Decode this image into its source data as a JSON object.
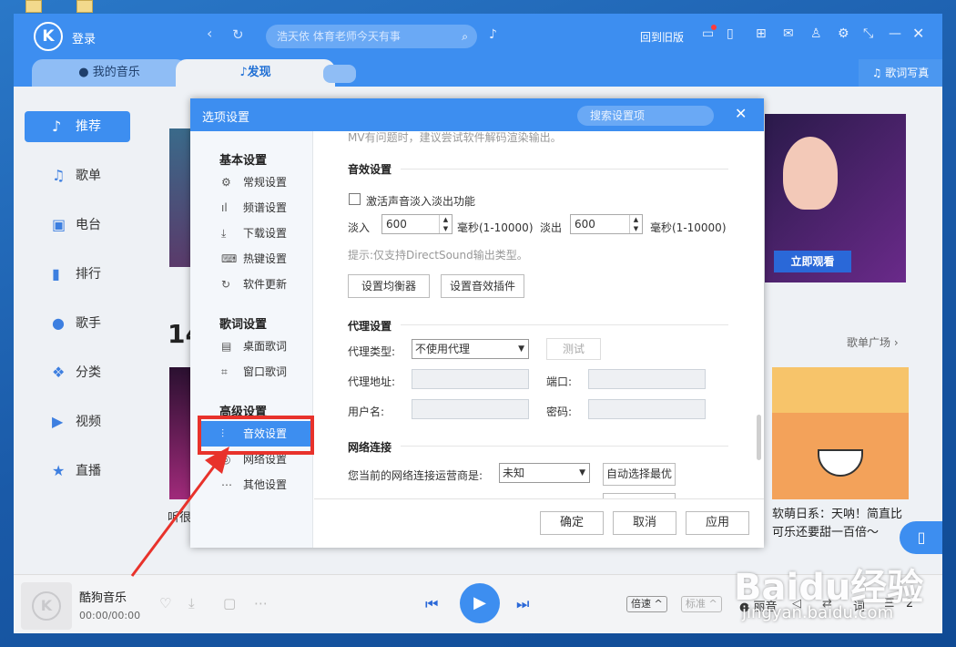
{
  "app": {
    "login": "登录",
    "search_placeholder": "浩天依 体育老师今天有事",
    "old_version": "回到旧版",
    "logo_letter": "K"
  },
  "tabs": {
    "my_music": "我的音乐",
    "discover": "发现",
    "lyrics_photo": "歌词写真"
  },
  "sidebar": {
    "items": [
      {
        "label": "推荐",
        "icon": "music-note-icon"
      },
      {
        "label": "歌单",
        "icon": "playlist-icon"
      },
      {
        "label": "电台",
        "icon": "radio-icon"
      },
      {
        "label": "排行",
        "icon": "chart-icon"
      },
      {
        "label": "歌手",
        "icon": "singer-icon"
      },
      {
        "label": "分类",
        "icon": "category-icon"
      },
      {
        "label": "视频",
        "icon": "video-icon"
      },
      {
        "label": "直播",
        "icon": "live-icon"
      }
    ]
  },
  "content": {
    "section_number": "14",
    "playlist_square": "歌单广场 ›",
    "banner_button": "立即观看",
    "left_caption": "听很",
    "right_caption": "软萌日系：天呐！简直比可乐还要甜一百倍～"
  },
  "player": {
    "song": "酷狗音乐",
    "time": "00:00/00:00",
    "speed": "倍速",
    "quality": "标准",
    "effect": "丽音",
    "lyric": "词",
    "count": "2"
  },
  "dialog": {
    "title": "选项设置",
    "search": "搜索设置项",
    "groups": {
      "basic": "基本设置",
      "lyrics": "歌词设置",
      "advanced": "高级设置"
    },
    "items": {
      "general": "常规设置",
      "spectrum": "频谱设置",
      "download": "下载设置",
      "hotkey": "热键设置",
      "update": "软件更新",
      "desktop_lyric": "桌面歌词",
      "window_lyric": "窗口歌词",
      "sound_effect": "音效设置",
      "network": "网络设置",
      "other": "其他设置"
    },
    "cut_text": "MV有问题时，建议尝试软件解码渲染输出。",
    "sound": {
      "title": "音效设置",
      "fade_check": "激活声音淡入淡出功能",
      "fade_in_label": "淡入",
      "fade_in_value": "600",
      "fade_in_unit": "毫秒(1-10000)",
      "fade_out_label": "淡出",
      "fade_out_value": "600",
      "fade_out_unit": "毫秒(1-10000)",
      "hint": "提示:仅支持DirectSound输出类型。",
      "eq_button": "设置均衡器",
      "plugin_button": "设置音效插件"
    },
    "proxy": {
      "title": "代理设置",
      "type_label": "代理类型:",
      "type_value": "不使用代理",
      "test_button": "测试",
      "addr_label": "代理地址:",
      "port_label": "端口:",
      "user_label": "用户名:",
      "pass_label": "密码:"
    },
    "network": {
      "title": "网络连接",
      "isp_label": "您当前的网络连接运营商是:",
      "isp_value": "未知",
      "auto_button": "自动选择最优"
    },
    "buttons": {
      "ok": "确定",
      "cancel": "取消",
      "apply": "应用"
    }
  },
  "watermark": {
    "brand": "Baidu经验",
    "url": "jingyan.baidu.com"
  },
  "colors": {
    "accent": "#3d8ef0",
    "highlight_box": "#e8322b"
  }
}
